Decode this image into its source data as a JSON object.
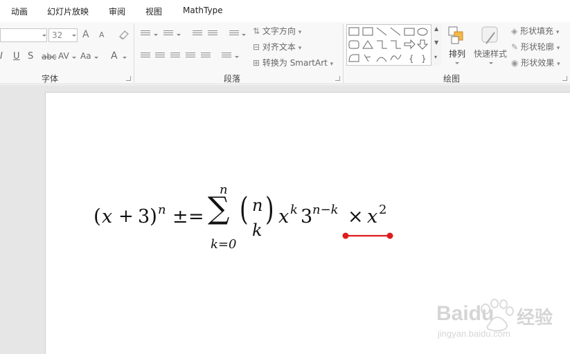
{
  "menu": [
    "动画",
    "幻灯片放映",
    "审阅",
    "视图",
    "MathType"
  ],
  "font_group": {
    "label": "字体",
    "font_name_value": "",
    "font_size_value": "32",
    "grow_label": "A",
    "shrink_label": "A",
    "italic_label": "I",
    "underline_label": "U",
    "strike_label": "S",
    "strike_text": "abc",
    "spacing_label": "AV",
    "case_label": "Aa",
    "color_label": "A"
  },
  "paragraph_group": {
    "label": "段落",
    "text_direction_label": "文字方向",
    "align_text_label": "对齐文本",
    "smartart_label": "转换为 SmartArt"
  },
  "drawing_group": {
    "label": "绘图",
    "arrange_label": "排列",
    "quick_styles_label": "快速样式",
    "shape_fill_label": "形状填充",
    "shape_outline_label": "形状轮廓",
    "shape_effects_label": "形状效果",
    "gallery_brace_left": "{",
    "gallery_brace_right": "}"
  },
  "equation": {
    "open_paren": "(",
    "var_x": "x",
    "plus": "+",
    "three": "3",
    "close_paren": ")",
    "exp_n": "n",
    "pm": "±",
    "equals": "=",
    "sigma": "∑",
    "sum_upper": "n",
    "sum_lower": "k=0",
    "binom_open": "(",
    "binom_top": "n",
    "binom_bottom": "k",
    "binom_close": ")",
    "x_base": "x",
    "x_exp": "k",
    "three_base": "3",
    "three_exp": "n−k",
    "times": "×",
    "x2_base": "x",
    "x2_exp": "2"
  },
  "annotation": {
    "color": "#e01b1b"
  },
  "watermark": {
    "brand": "Baidu",
    "brand_cn": "经验",
    "url": "jingyan.baidu.com"
  }
}
